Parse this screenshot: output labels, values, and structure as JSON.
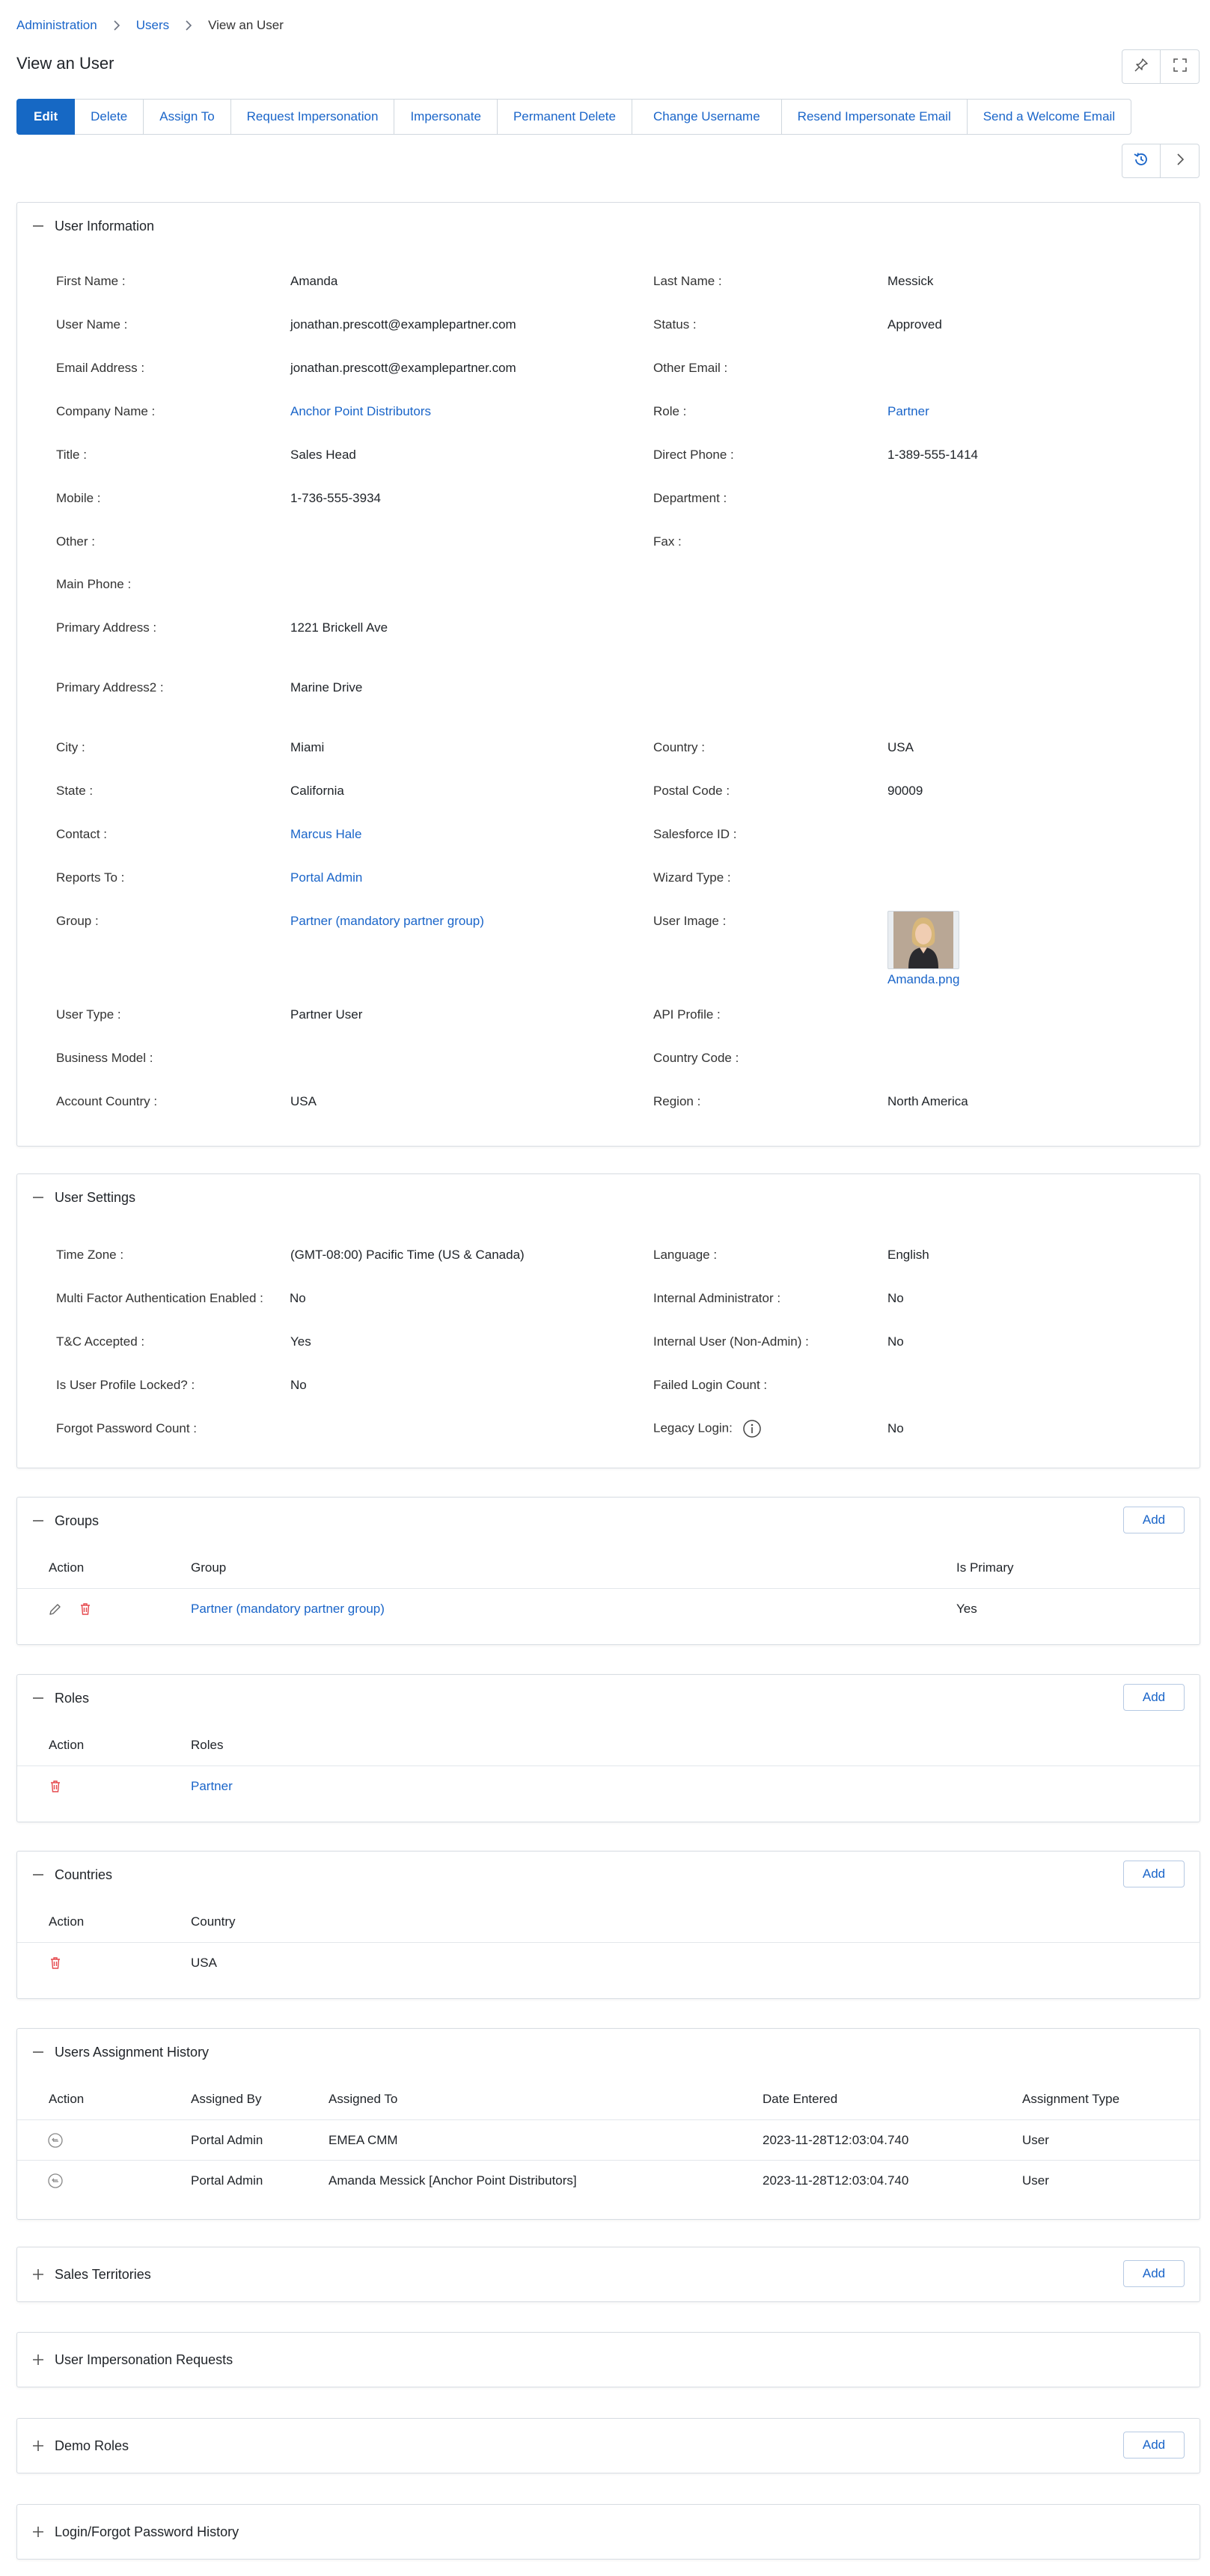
{
  "breadcrumb": {
    "root": "Administration",
    "parent": "Users",
    "current": "View an User"
  },
  "page": {
    "title": "View an User"
  },
  "toolbar": {
    "edit": "Edit",
    "delete": "Delete",
    "assign_to": "Assign To",
    "request_impersonation": "Request Impersonation",
    "impersonate": "Impersonate",
    "permanent_delete": "Permanent Delete",
    "change_username": "Change Username",
    "resend_impersonate_email": "Resend Impersonate Email",
    "send_welcome_email": "Send a Welcome Email"
  },
  "user_info": {
    "title": "User Information",
    "first_name": {
      "label": "First Name :",
      "value": "Amanda"
    },
    "last_name": {
      "label": "Last Name :",
      "value": "Messick"
    },
    "user_name": {
      "label": "User Name :",
      "value": "jonathan.prescott@examplepartner.com"
    },
    "status": {
      "label": "Status :",
      "value": "Approved"
    },
    "email": {
      "label": "Email Address :",
      "value": "jonathan.prescott@examplepartner.com"
    },
    "other_email": {
      "label": "Other Email :",
      "value": ""
    },
    "company_name": {
      "label": "Company Name :",
      "value": "Anchor Point Distributors"
    },
    "role": {
      "label": "Role :",
      "value": "Partner"
    },
    "title_field": {
      "label": "Title :",
      "value": "Sales Head"
    },
    "direct_phone": {
      "label": "Direct Phone :",
      "value": "1-389-555-1414"
    },
    "mobile": {
      "label": "Mobile :",
      "value": "1-736-555-3934"
    },
    "department": {
      "label": "Department :",
      "value": ""
    },
    "other": {
      "label": "Other :",
      "value": ""
    },
    "fax": {
      "label": "Fax :",
      "value": ""
    },
    "main_phone": {
      "label": "Main Phone :",
      "value": ""
    },
    "primary_address": {
      "label": "Primary Address :",
      "value": "1221 Brickell Ave"
    },
    "primary_address2": {
      "label": "Primary Address2 :",
      "value": "Marine Drive"
    },
    "city": {
      "label": "City :",
      "value": "Miami"
    },
    "country": {
      "label": "Country :",
      "value": "USA"
    },
    "state": {
      "label": "State :",
      "value": "California"
    },
    "postal_code": {
      "label": "Postal Code :",
      "value": "90009"
    },
    "contact": {
      "label": "Contact :",
      "value": "Marcus Hale"
    },
    "salesforce_id": {
      "label": "Salesforce ID :",
      "value": ""
    },
    "reports_to": {
      "label": "Reports To :",
      "value": "Portal Admin"
    },
    "wizard_type": {
      "label": "Wizard Type :",
      "value": ""
    },
    "group": {
      "label": "Group :",
      "value": "Partner (mandatory partner group)"
    },
    "user_image": {
      "label": "User Image :",
      "file": "Amanda.png"
    },
    "user_type": {
      "label": "User Type :",
      "value": "Partner User"
    },
    "api_profile": {
      "label": "API Profile :",
      "value": ""
    },
    "business_model": {
      "label": "Business Model :",
      "value": ""
    },
    "country_code": {
      "label": "Country Code :",
      "value": ""
    },
    "account_country": {
      "label": "Account Country :",
      "value": "USA"
    },
    "region": {
      "label": "Region :",
      "value": "North America"
    }
  },
  "user_settings": {
    "title": "User Settings",
    "time_zone": {
      "label": "Time Zone :",
      "value": "(GMT-08:00) Pacific Time (US & Canada)"
    },
    "language": {
      "label": "Language :",
      "value": "English"
    },
    "mfa": {
      "label": "Multi Factor Authentication Enabled :",
      "value": "No"
    },
    "internal_admin": {
      "label": "Internal Administrator :",
      "value": "No"
    },
    "tc_accepted": {
      "label": "T&C Accepted :",
      "value": "Yes"
    },
    "internal_user": {
      "label": "Internal User (Non-Admin) :",
      "value": "No"
    },
    "profile_locked": {
      "label": "Is User Profile Locked? :",
      "value": "No"
    },
    "failed_login": {
      "label": "Failed Login Count :",
      "value": ""
    },
    "forgot_password": {
      "label": "Forgot Password Count :",
      "value": ""
    },
    "legacy_login": {
      "label": "Legacy Login:",
      "value": "No"
    }
  },
  "groups": {
    "title": "Groups",
    "add": "Add",
    "headers": {
      "action": "Action",
      "group": "Group",
      "is_primary": "Is Primary"
    },
    "rows": [
      {
        "group": "Partner (mandatory partner group)",
        "is_primary": "Yes"
      }
    ]
  },
  "roles": {
    "title": "Roles",
    "add": "Add",
    "headers": {
      "action": "Action",
      "roles": "Roles"
    },
    "rows": [
      {
        "role": "Partner"
      }
    ]
  },
  "countries": {
    "title": "Countries",
    "add": "Add",
    "headers": {
      "action": "Action",
      "country": "Country"
    },
    "rows": [
      {
        "country": "USA"
      }
    ]
  },
  "assignment_history": {
    "title": "Users Assignment History",
    "headers": {
      "action": "Action",
      "assigned_by": "Assigned By",
      "assigned_to": "Assigned To",
      "date_entered": "Date Entered",
      "assignment_type": "Assignment Type"
    },
    "rows": [
      {
        "assigned_by": "Portal Admin",
        "assigned_to": "EMEA CMM",
        "date_entered": "2023-11-28T12:03:04.740",
        "assignment_type": "User"
      },
      {
        "assigned_by": "Portal Admin",
        "assigned_to": "Amanda Messick [Anchor Point Distributors]",
        "date_entered": "2023-11-28T12:03:04.740",
        "assignment_type": "User"
      }
    ]
  },
  "sales_territories": {
    "title": "Sales Territories",
    "add": "Add"
  },
  "impersonation_requests": {
    "title": "User Impersonation Requests"
  },
  "demo_roles": {
    "title": "Demo Roles",
    "add": "Add"
  },
  "login_history": {
    "title": "Login/Forgot Password History"
  },
  "colors": {
    "accent": "#1668c4",
    "link": "#1a65c9",
    "danger": "#e5484d",
    "border": "#d8dde3"
  }
}
